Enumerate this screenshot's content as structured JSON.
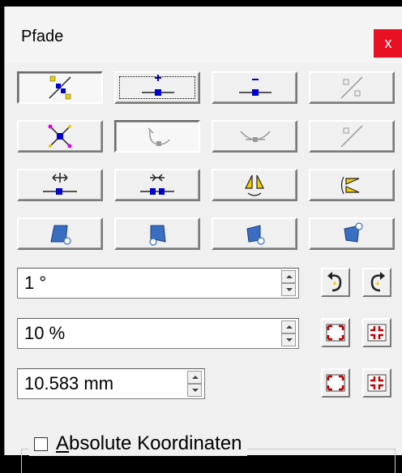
{
  "window": {
    "title": "Pfade",
    "close_glyph": "x",
    "accent_close": "#e81123"
  },
  "toolbar": {
    "rows": [
      [
        {
          "icon": "break-path-icon",
          "state": "pressed"
        },
        {
          "icon": "add-node-icon",
          "state": "focused"
        },
        {
          "icon": "remove-node-icon",
          "state": "normal"
        },
        {
          "icon": "join-nodes-icon",
          "state": "disabled"
        }
      ],
      [
        {
          "icon": "smooth-node-icon",
          "state": "normal"
        },
        {
          "icon": "corner-node-icon",
          "state": "pressed-disabled"
        },
        {
          "icon": "symmetric-node-icon",
          "state": "disabled"
        },
        {
          "icon": "cusp-node-icon",
          "state": "disabled"
        }
      ],
      [
        {
          "icon": "spread-horizontal-icon",
          "state": "normal"
        },
        {
          "icon": "contract-horizontal-icon",
          "state": "normal"
        },
        {
          "icon": "mirror-vertical-icon",
          "state": "normal"
        },
        {
          "icon": "mirror-horizontal-icon",
          "state": "normal"
        }
      ],
      [
        {
          "icon": "skew-left-icon",
          "state": "normal"
        },
        {
          "icon": "skew-down-icon",
          "state": "normal"
        },
        {
          "icon": "skew-right-icon",
          "state": "normal"
        },
        {
          "icon": "skew-up-icon",
          "state": "normal"
        }
      ]
    ]
  },
  "controls": {
    "angle": {
      "value": "1 °"
    },
    "scale": {
      "value": "10 %"
    },
    "offset": {
      "value": "10.583 mm"
    }
  },
  "absolute_coords": {
    "label_first": "A",
    "label_rest": "bsolute Koordinaten",
    "checked": false
  }
}
